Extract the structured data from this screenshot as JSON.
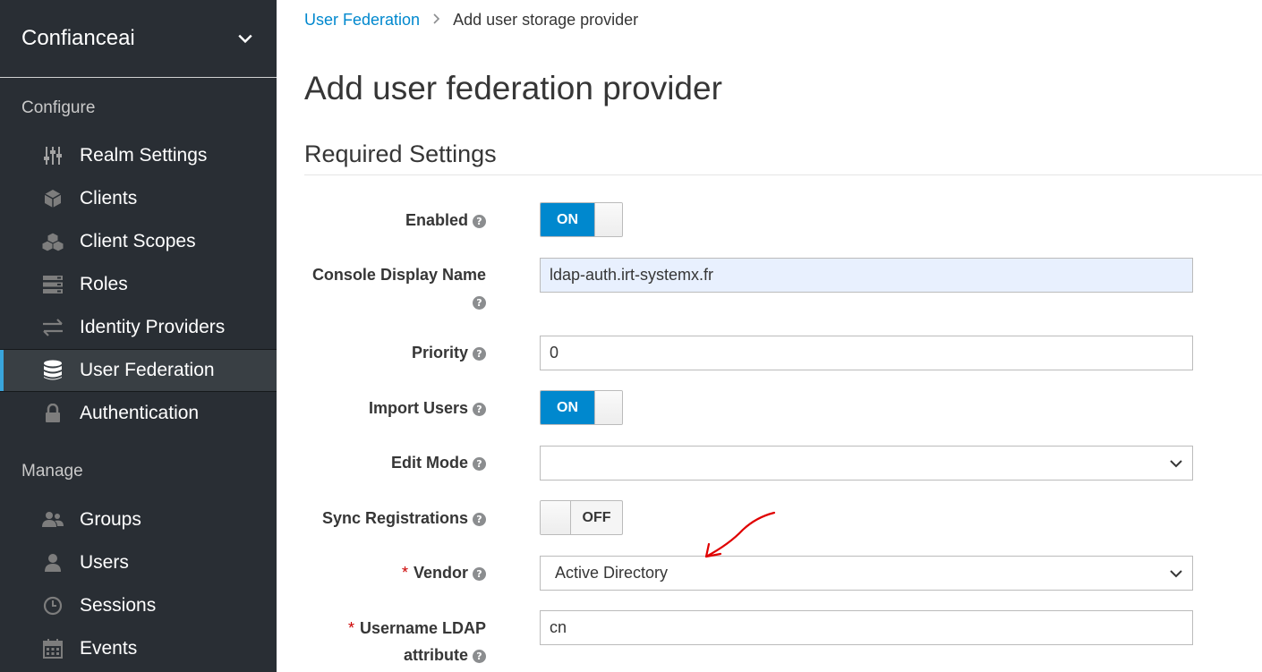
{
  "realm": {
    "name": "Confianceai"
  },
  "sidebar": {
    "configure_title": "Configure",
    "manage_title": "Manage",
    "configure_items": [
      {
        "label": "Realm Settings",
        "icon": "sliders-icon"
      },
      {
        "label": "Clients",
        "icon": "cube-icon"
      },
      {
        "label": "Client Scopes",
        "icon": "cubes-icon"
      },
      {
        "label": "Roles",
        "icon": "server-icon"
      },
      {
        "label": "Identity Providers",
        "icon": "exchange-icon"
      },
      {
        "label": "User Federation",
        "icon": "database-icon",
        "active": true
      },
      {
        "label": "Authentication",
        "icon": "lock-icon"
      }
    ],
    "manage_items": [
      {
        "label": "Groups",
        "icon": "users-icon"
      },
      {
        "label": "Users",
        "icon": "user-icon"
      },
      {
        "label": "Sessions",
        "icon": "clock-icon"
      },
      {
        "label": "Events",
        "icon": "calendar-icon"
      }
    ]
  },
  "breadcrumb": {
    "parent": "User Federation",
    "current": "Add user storage provider"
  },
  "page": {
    "title": "Add user federation provider",
    "section": "Required Settings"
  },
  "form": {
    "enabled": {
      "label": "Enabled",
      "value": "ON"
    },
    "console_display_name": {
      "label": "Console Display Name",
      "value": "ldap-auth.irt-systemx.fr"
    },
    "priority": {
      "label": "Priority",
      "value": "0"
    },
    "import_users": {
      "label": "Import Users",
      "value": "ON"
    },
    "edit_mode": {
      "label": "Edit Mode",
      "value": ""
    },
    "sync_registrations": {
      "label": "Sync Registrations",
      "value": "OFF"
    },
    "vendor": {
      "label": "Vendor",
      "value": "Active Directory"
    },
    "username_ldap_attribute": {
      "label_line1": "Username LDAP",
      "label_line2": "attribute",
      "value": "cn"
    }
  },
  "colors": {
    "sidebar_bg": "#292e34",
    "accent": "#0088ce",
    "active_bar": "#39a5dc",
    "annotation": "#e00000"
  }
}
